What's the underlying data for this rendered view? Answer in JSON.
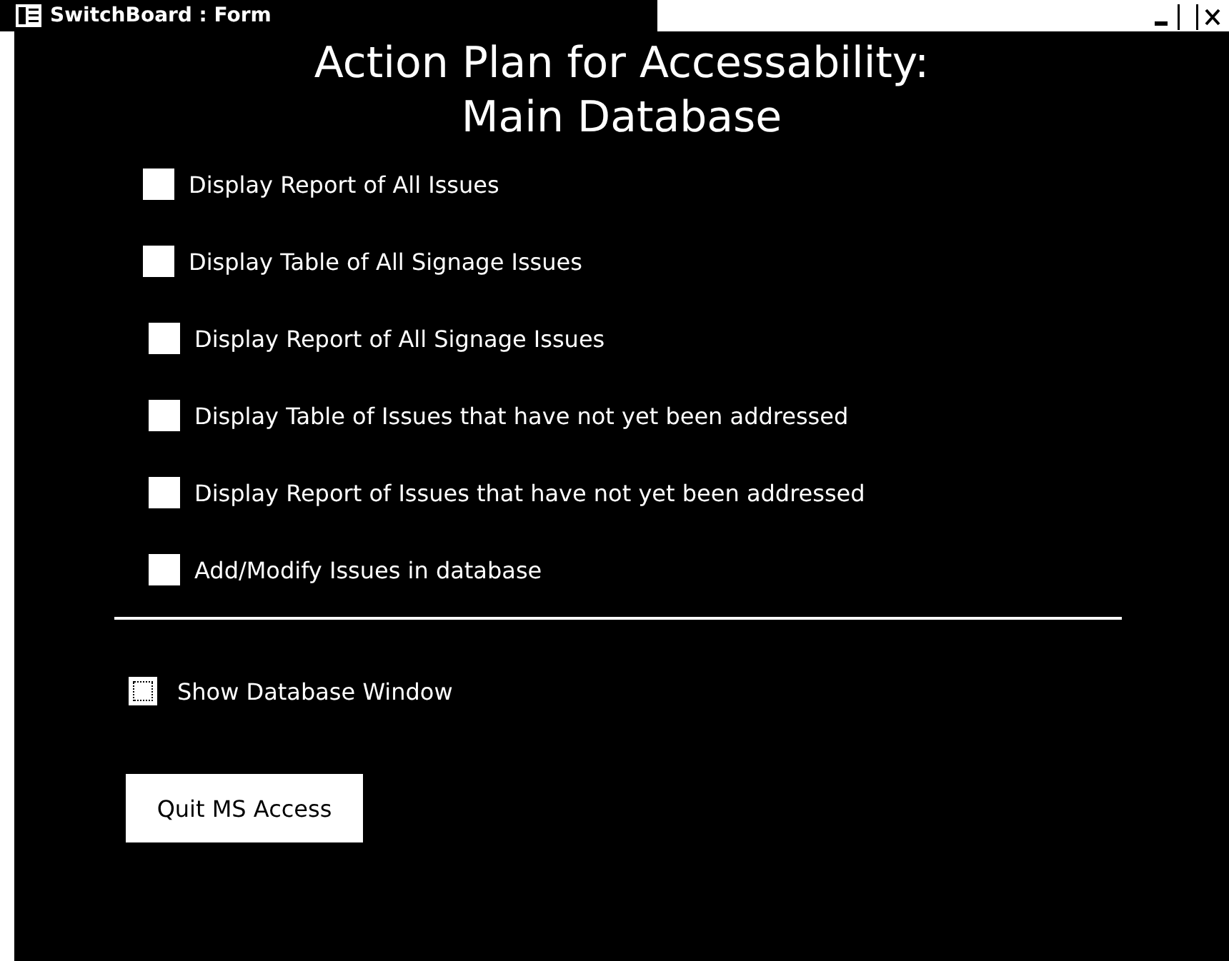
{
  "window": {
    "title": "SwitchBoard : Form"
  },
  "heading": [
    "Action Plan for Accessability:",
    "Main Database"
  ],
  "items": [
    {
      "label": "Display Report of All Issues"
    },
    {
      "label": "Display Table of All Signage Issues"
    },
    {
      "label": "Display Report of All Signage Issues"
    },
    {
      "label": "Display Table of Issues that have not yet been addressed"
    },
    {
      "label": "Display Report of Issues that have not yet been addressed"
    },
    {
      "label": "Add/Modify Issues in database"
    }
  ],
  "show_database_window": {
    "label": "Show Database Window",
    "checked": false
  },
  "quit_button": "Quit MS Access"
}
